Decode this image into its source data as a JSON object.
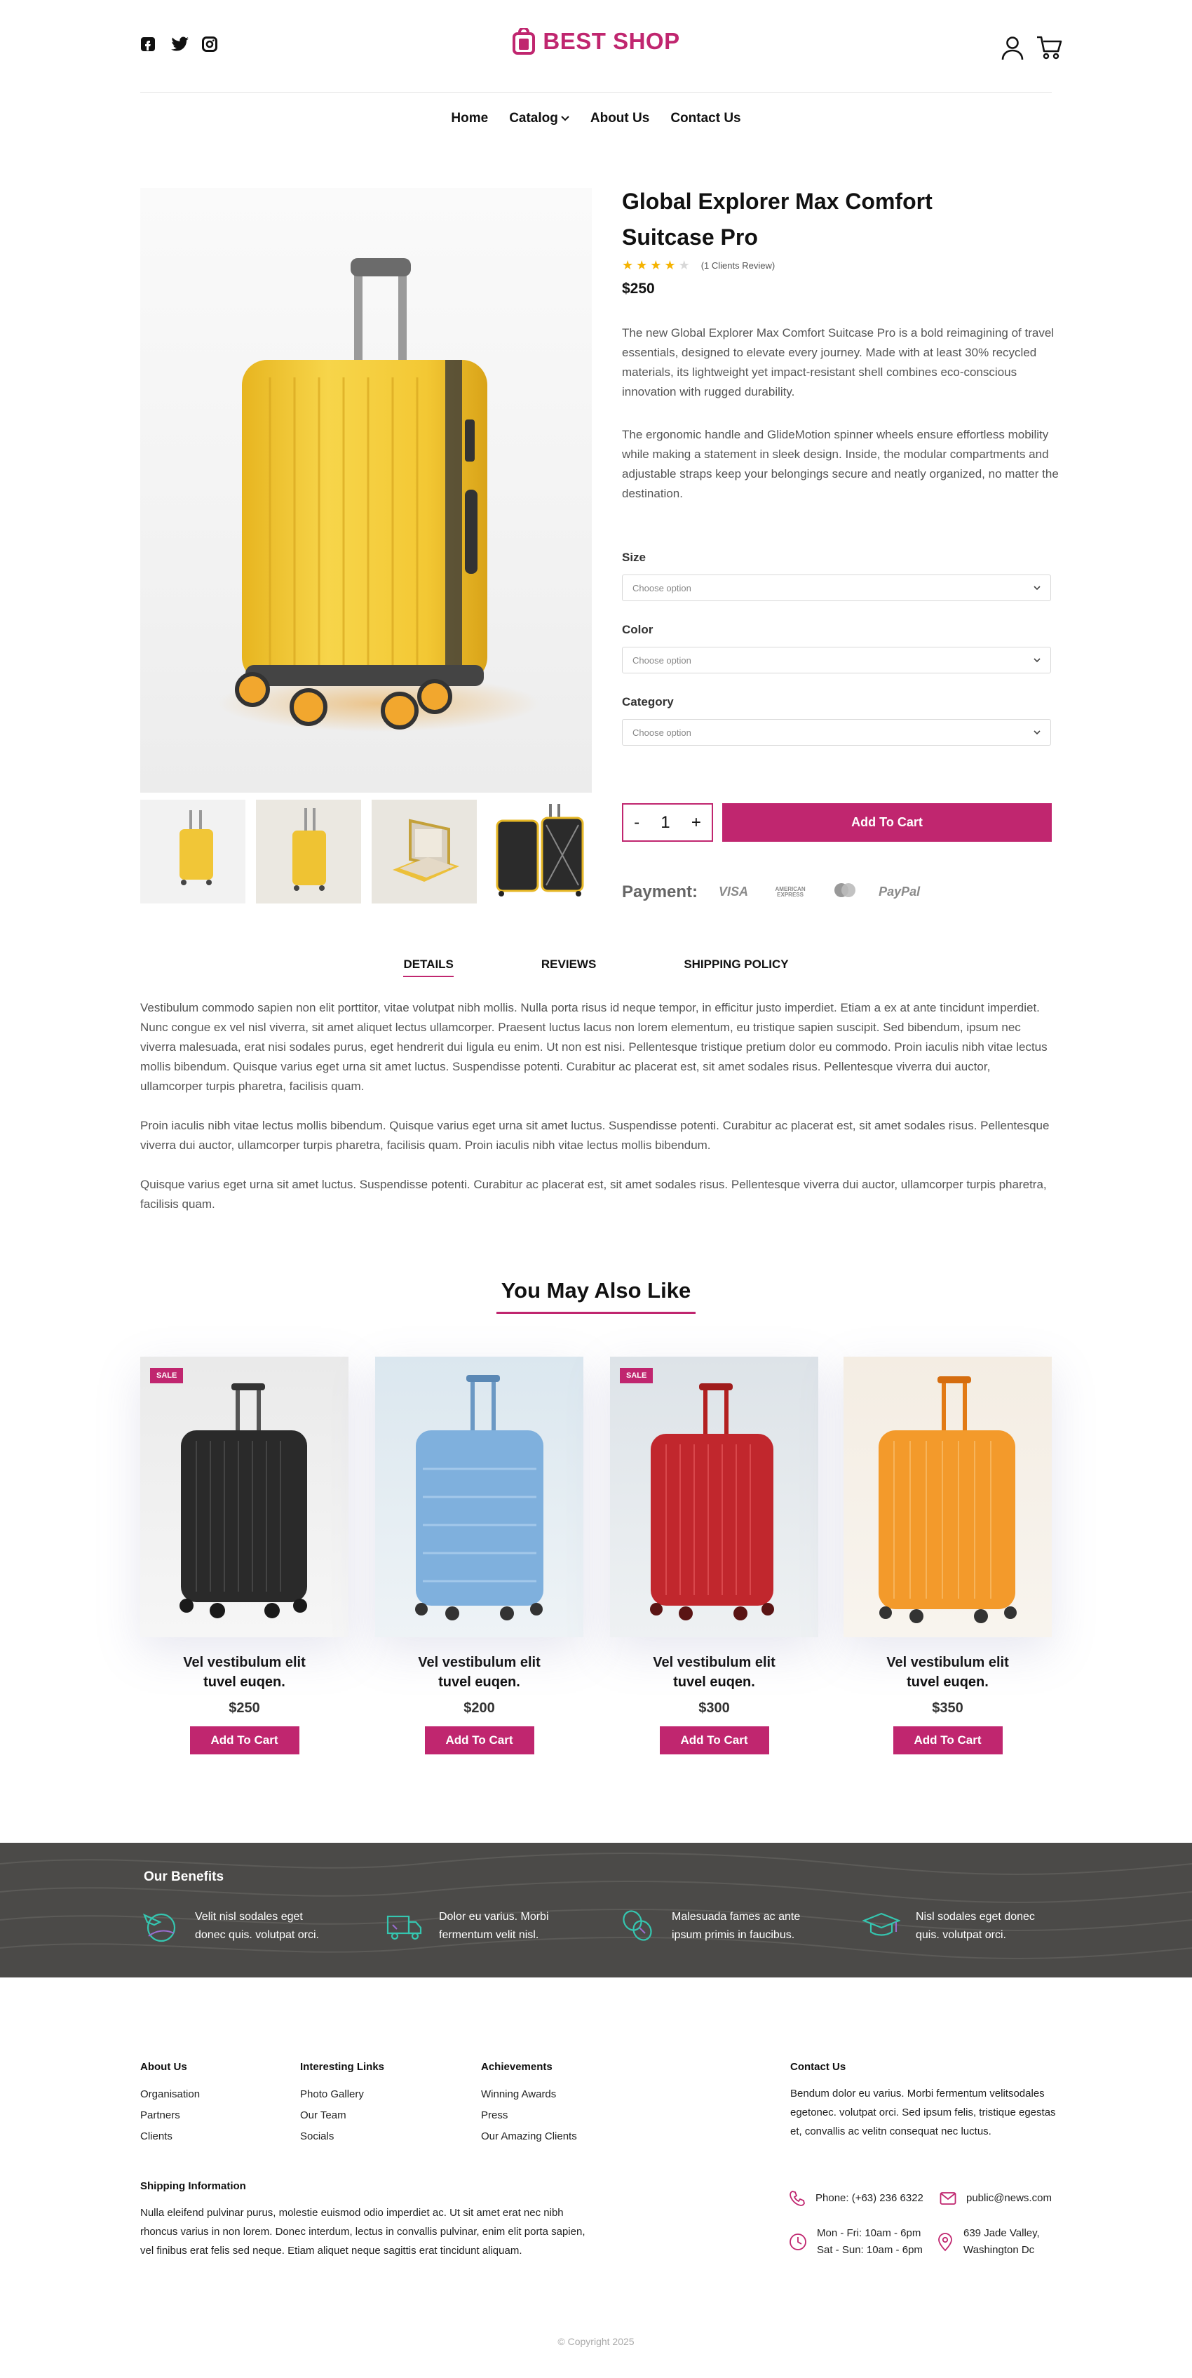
{
  "header": {
    "logo_text": "BEST SHOP",
    "social_icons": [
      "facebook-icon",
      "twitter-icon",
      "instagram-icon"
    ],
    "nav": [
      "Home",
      "Catalog",
      "About Us",
      "Contact Us"
    ]
  },
  "product": {
    "title": "Global Explorer Max Comfort Suitcase Pro",
    "rating": 4,
    "rating_max": 5,
    "reviews_text": "(1 Clients Review)",
    "price": "$250",
    "description_1": "The new Global Explorer Max Comfort Suitcase Pro is a bold reimagining of travel essentials, designed to elevate every journey. Made with at least 30% recycled materials, its lightweight yet impact-resistant shell combines eco-conscious innovation with rugged durability.",
    "description_2": "The ergonomic handle and GlideMotion spinner wheels ensure effortless mobility while making a statement in sleek design. Inside, the modular compartments and adjustable straps keep your belongings secure and neatly organized, no matter the destination.",
    "options": [
      {
        "label": "Size",
        "placeholder": "Choose option"
      },
      {
        "label": "Color",
        "placeholder": "Choose option"
      },
      {
        "label": "Category",
        "placeholder": "Choose option"
      }
    ],
    "qty_minus": "-",
    "qty_value": "1",
    "qty_plus": "+",
    "add_to_cart": "Add To Cart",
    "payment_label": "Payment:",
    "payment_methods": [
      "VISA",
      "AMERICAN EXPRESS",
      "mastercard",
      "PayPal"
    ]
  },
  "tabs": {
    "items": [
      "DETAILS",
      "REVIEWS",
      "SHIPPING POLICY"
    ],
    "active": "DETAILS",
    "details_p1": "Vestibulum commodo sapien non elit porttitor, vitae volutpat nibh mollis. Nulla porta risus id neque tempor, in efficitur justo imperdiet. Etiam a ex at ante tincidunt imperdiet. Nunc congue ex vel nisl viverra, sit amet aliquet lectus ullamcorper. Praesent luctus lacus non lorem elementum, eu tristique sapien suscipit. Sed bibendum, ipsum nec viverra malesuada, erat nisi sodales purus, eget hendrerit dui ligula eu enim. Ut non est nisi. Pellentesque tristique pretium dolor eu commodo. Proin iaculis nibh vitae lectus mollis bibendum. Quisque varius eget urna sit amet luctus. Suspendisse potenti. Curabitur ac placerat est, sit amet sodales risus. Pellentesque viverra dui auctor, ullamcorper turpis pharetra, facilisis quam.",
    "details_p2": "Proin iaculis nibh vitae lectus mollis bibendum. Quisque varius eget urna sit amet luctus. Suspendisse potenti. Curabitur ac placerat est, sit amet sodales risus. Pellentesque viverra dui auctor, ullamcorper turpis pharetra, facilisis quam. Proin iaculis nibh vitae lectus mollis bibendum.",
    "details_p3": "Quisque varius eget urna sit amet luctus. Suspendisse potenti. Curabitur ac placerat est, sit amet sodales risus. Pellentesque viverra dui auctor, ullamcorper turpis pharetra, facilisis quam."
  },
  "related": {
    "title": "You May Also Like",
    "products": [
      {
        "title": "Vel vestibulum elit tuvel euqen.",
        "price": "$250",
        "button": "Add To Cart",
        "badge": "SALE",
        "color": "#2a2a2a"
      },
      {
        "title": "Vel vestibulum elit tuvel euqen.",
        "price": "$200",
        "button": "Add To Cart",
        "badge": "",
        "color": "#7fb0dd"
      },
      {
        "title": "Vel vestibulum elit tuvel euqen.",
        "price": "$300",
        "button": "Add To Cart",
        "badge": "SALE",
        "color": "#c1272d"
      },
      {
        "title": "Vel vestibulum elit tuvel euqen.",
        "price": "$350",
        "button": "Add To Cart",
        "badge": "",
        "color": "#f39a2b"
      }
    ]
  },
  "benefits": {
    "title": "Our Benefits",
    "items": [
      {
        "icon": "airplane-globe-icon",
        "text": "Velit nisl sodales eget donec quis. volutpat orci."
      },
      {
        "icon": "delivery-truck-icon",
        "text": "Dolor eu varius. Morbi fermentum velit nisl."
      },
      {
        "icon": "coins-icon",
        "text": "Malesuada fames ac ante ipsum primis in faucibus."
      },
      {
        "icon": "graduation-cap-icon",
        "text": "Nisl sodales eget donec quis. volutpat orci."
      }
    ]
  },
  "footer": {
    "about": {
      "heading": "About Us",
      "links": [
        "Organisation",
        "Partners",
        "Clients"
      ]
    },
    "links": {
      "heading": "Interesting Links",
      "links": [
        "Photo Gallery",
        "Our Team",
        "Socials"
      ]
    },
    "achievements": {
      "heading": "Achievements",
      "links": [
        "Winning Awards",
        "Press",
        "Our Amazing Clients"
      ]
    },
    "contact": {
      "heading": "Contact Us",
      "text": "Bendum dolor eu varius. Morbi fermentum velitsodales egetonec. volutpat orci. Sed ipsum felis, tristique egestas et, convallis ac velitn consequat nec luctus.",
      "phone": "Phone: (+63) 236 6322",
      "email": "public@news.com",
      "hours_1": "Mon - Fri: 10am - 6pm",
      "hours_2": "Sat - Sun: 10am - 6pm",
      "address_1": "639 Jade Valley,",
      "address_2": "Washington Dc"
    },
    "shipping": {
      "heading": "Shipping Information",
      "text": "Nulla eleifend pulvinar purus, molestie euismod odio imperdiet ac. Ut sit amet erat nec nibh rhoncus varius in non lorem. Donec interdum, lectus in convallis pulvinar, enim elit porta sapien, vel finibus erat felis sed neque. Etiam aliquet neque sagittis erat tincidunt aliquam."
    },
    "copyright": "© Copyright 2025"
  },
  "colors": {
    "accent": "#c0266f",
    "benefits_bg": "#4b4a48",
    "benefit_icon": "#35c6b0",
    "star": "#f5b301"
  }
}
